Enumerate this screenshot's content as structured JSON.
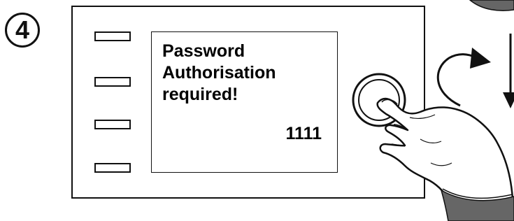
{
  "step": {
    "number": "4"
  },
  "display": {
    "line1": "Password",
    "line2": "Authorisation",
    "line3": "required!",
    "code": "1111"
  },
  "icons": {
    "knob": "rotary-knob-icon",
    "hand": "pressing-hand-icon",
    "rotate_arrow": "rotate-clockwise-arrow-icon",
    "down_arrow": "down-arrow-icon"
  }
}
